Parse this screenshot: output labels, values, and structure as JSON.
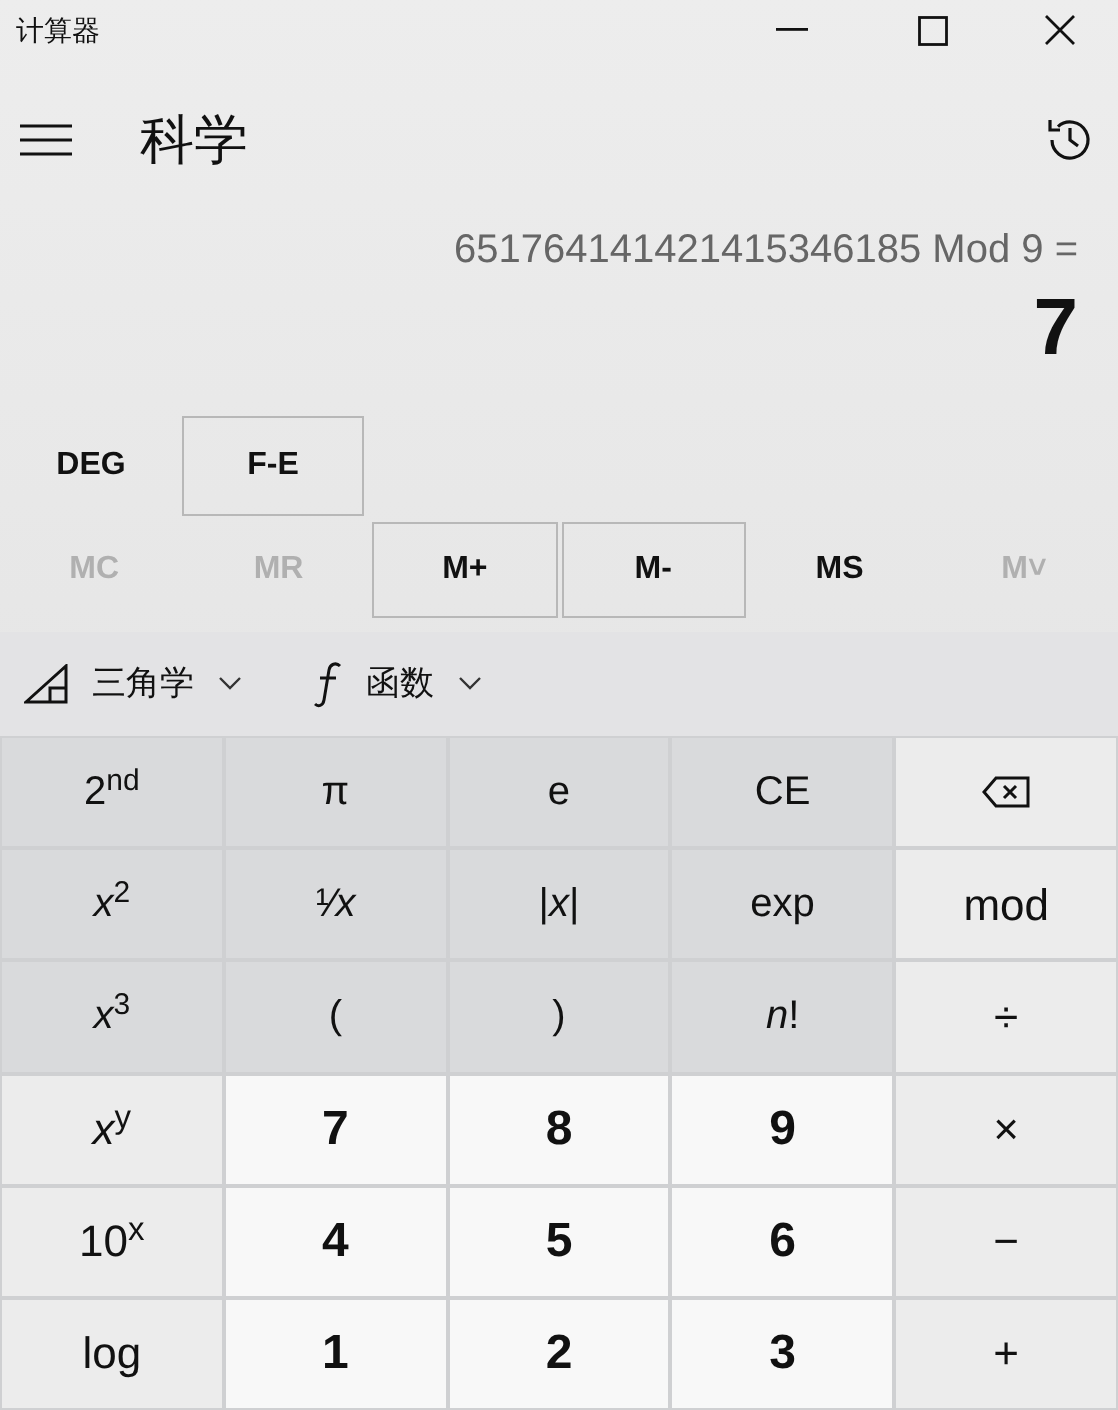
{
  "window": {
    "title": "计算器"
  },
  "header": {
    "mode": "科学"
  },
  "display": {
    "expression": "651764141421415346185 Mod 9 =",
    "result": "7"
  },
  "mode_buttons": [
    {
      "label": "DEG",
      "highlighted": false
    },
    {
      "label": "F-E",
      "highlighted": true
    }
  ],
  "memory_buttons": [
    {
      "label": "MC",
      "disabled": true,
      "highlighted": false
    },
    {
      "label": "MR",
      "disabled": true,
      "highlighted": false
    },
    {
      "label": "M+",
      "disabled": false,
      "highlighted": true
    },
    {
      "label": "M-",
      "disabled": false,
      "highlighted": true
    },
    {
      "label": "MS",
      "disabled": false,
      "highlighted": false
    },
    {
      "label": "M˅",
      "disabled": true,
      "highlighted": false
    }
  ],
  "dropdowns": [
    {
      "kind": "trig",
      "label": "三角学"
    },
    {
      "kind": "function",
      "label": "函数"
    }
  ],
  "keys": [
    {
      "kind": "function",
      "label": "2$^{nd}$"
    },
    {
      "kind": "function",
      "label": "π"
    },
    {
      "kind": "function",
      "label": "e"
    },
    {
      "kind": "function",
      "label": "CE"
    },
    {
      "kind": "backspace"
    },
    {
      "kind": "function",
      "label": "*x*$^{2}$"
    },
    {
      "kind": "function",
      "label": "¹⁄*x*"
    },
    {
      "kind": "function",
      "label": "|*x*|"
    },
    {
      "kind": "function",
      "label": "exp"
    },
    {
      "kind": "operator",
      "label": "mod"
    },
    {
      "kind": "function",
      "label": "*x*$^{3}$"
    },
    {
      "kind": "function",
      "label": "("
    },
    {
      "kind": "function",
      "label": ")"
    },
    {
      "kind": "function",
      "label": "*n*!"
    },
    {
      "kind": "operator",
      "label": "÷"
    },
    {
      "kind": "operator",
      "label": "*x*$^{y}$"
    },
    {
      "kind": "digit",
      "label": "7"
    },
    {
      "kind": "digit",
      "label": "8"
    },
    {
      "kind": "digit",
      "label": "9"
    },
    {
      "kind": "operator",
      "label": "×"
    },
    {
      "kind": "operator",
      "label": "10$^{x}$"
    },
    {
      "kind": "digit",
      "label": "4"
    },
    {
      "kind": "digit",
      "label": "5"
    },
    {
      "kind": "digit",
      "label": "6"
    },
    {
      "kind": "operator",
      "label": "−"
    },
    {
      "kind": "operator",
      "label": "log"
    },
    {
      "kind": "digit",
      "label": "1"
    },
    {
      "kind": "digit",
      "label": "2"
    },
    {
      "kind": "digit",
      "label": "3"
    },
    {
      "kind": "operator",
      "label": "+"
    }
  ]
}
